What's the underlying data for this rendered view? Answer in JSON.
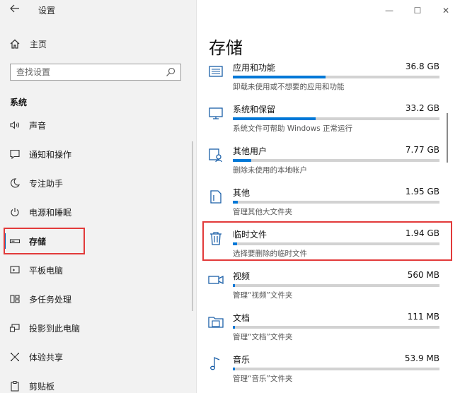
{
  "window": {
    "title": "设置",
    "controls": {
      "minimize": "—",
      "maximize": "☐",
      "close": "✕"
    }
  },
  "sidebar": {
    "home": "主页",
    "search_placeholder": "查找设置",
    "section": "系统",
    "items": [
      {
        "label": "声音",
        "icon": "speaker-icon",
        "selected": false
      },
      {
        "label": "通知和操作",
        "icon": "notification-icon",
        "selected": false
      },
      {
        "label": "专注助手",
        "icon": "moon-icon",
        "selected": false
      },
      {
        "label": "电源和睡眠",
        "icon": "power-icon",
        "selected": false
      },
      {
        "label": "存储",
        "icon": "storage-icon",
        "selected": true
      },
      {
        "label": "平板电脑",
        "icon": "tablet-icon",
        "selected": false
      },
      {
        "label": "多任务处理",
        "icon": "multitask-icon",
        "selected": false
      },
      {
        "label": "投影到此电脑",
        "icon": "project-icon",
        "selected": false
      },
      {
        "label": "体验共享",
        "icon": "share-icon",
        "selected": false
      },
      {
        "label": "剪贴板",
        "icon": "clipboard-icon",
        "selected": false
      }
    ]
  },
  "main": {
    "title": "存储",
    "items": [
      {
        "name": "应用和功能",
        "size": "36.8 GB",
        "desc": "卸载未使用或不想要的应用和功能",
        "fraction": 0.45,
        "icon": "apps-icon"
      },
      {
        "name": "系统和保留",
        "size": "33.2 GB",
        "desc": "系统文件可帮助 Windows 正常运行",
        "fraction": 0.4,
        "icon": "desktop-icon"
      },
      {
        "name": "其他用户",
        "size": "7.77 GB",
        "desc": "删除未使用的本地帐户",
        "fraction": 0.09,
        "icon": "users-icon"
      },
      {
        "name": "其他",
        "size": "1.95 GB",
        "desc": "管理其他大文件夹",
        "fraction": 0.025,
        "icon": "other-icon"
      },
      {
        "name": "临时文件",
        "size": "1.94 GB",
        "desc": "选择要删除的临时文件",
        "fraction": 0.022,
        "icon": "trash-icon"
      },
      {
        "name": "视频",
        "size": "560 MB",
        "desc": "管理“视频”文件夹",
        "fraction": 0.008,
        "icon": "video-icon"
      },
      {
        "name": "文档",
        "size": "111 MB",
        "desc": "管理“文档”文件夹",
        "fraction": 0.006,
        "icon": "documents-icon"
      },
      {
        "name": "音乐",
        "size": "53.9 MB",
        "desc": "管理“音乐”文件夹",
        "fraction": 0.005,
        "icon": "music-icon"
      }
    ]
  },
  "colors": {
    "accent": "#0078d7",
    "highlight": "#e23a3a",
    "sidebar_bg": "#f2f2f2"
  }
}
